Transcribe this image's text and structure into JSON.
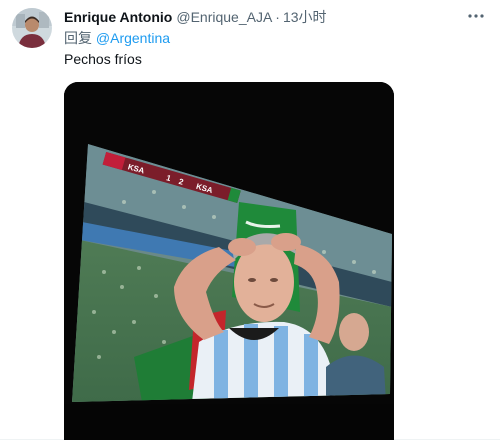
{
  "tweet": {
    "author": {
      "display_name": "Enrique Antonio",
      "handle": "@Enrique_AJA",
      "avatar_icon": "user-avatar"
    },
    "separator": "·",
    "timestamp": "13小时",
    "reply_prefix": "回复",
    "reply_mention": "@Argentina",
    "text": "Pechos fríos",
    "more_icon": "more-horizontal-icon"
  },
  "scoreboard": {
    "left_team": "KSA",
    "left_score": "1",
    "right_score": "2",
    "right_team": "KSA"
  },
  "colors": {
    "text_primary": "#0f1419",
    "text_secondary": "#536471",
    "accent": "#1d9bf0"
  }
}
